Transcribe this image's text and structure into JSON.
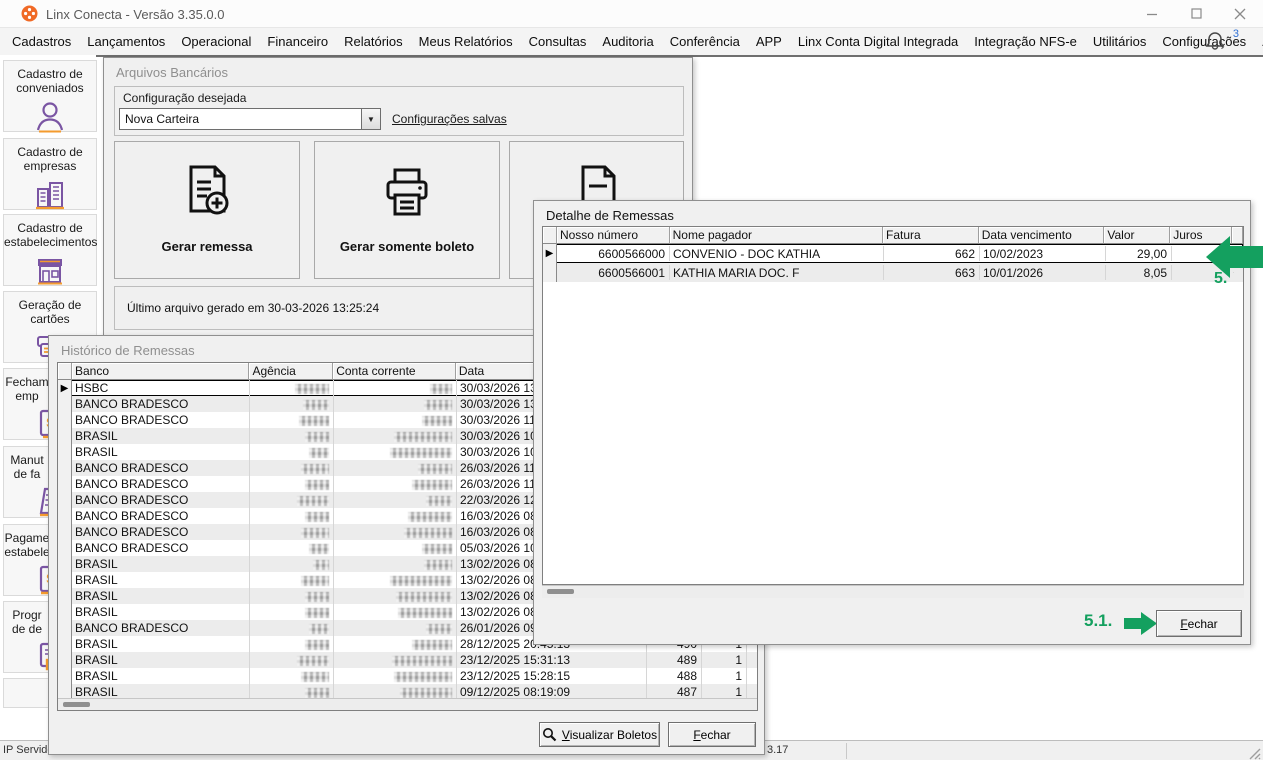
{
  "colors": {
    "green": "#14a05f",
    "purple": "#7a55a3",
    "orange": "#f49b2e",
    "logo_orange": "#f06a26",
    "bell_badge_blue": "#2f6fd4"
  },
  "app": {
    "title": "Linx Conecta - Versão 3.35.0.0",
    "bell_count": "3",
    "status_left": "IP Servido",
    "status_right": "3.17"
  },
  "menu": {
    "items": [
      "Cadastros",
      "Lançamentos",
      "Operacional",
      "Financeiro",
      "Relatórios",
      "Meus Relatórios",
      "Consultas",
      "Auditoria",
      "Conferência",
      "APP",
      "Linx Conta Digital Integrada",
      "Integração NFS-e",
      "Utilitários",
      "Configurações",
      "Ajuda"
    ]
  },
  "sidebar": {
    "items": [
      {
        "line1": "Cadastro de",
        "line2": "conveniados",
        "icon": "person-icon",
        "clipped": false
      },
      {
        "line1": "Cadastro de",
        "line2": "empresas",
        "icon": "buildings-icon",
        "clipped": false
      },
      {
        "line1": "Cadastro de",
        "line2": "estabelecimentos",
        "icon": "store-icon",
        "clipped": false
      },
      {
        "line1": "Geração de",
        "line2": "cartões",
        "icon": "cards-icon",
        "clipped": false
      },
      {
        "line1": "Fecham",
        "line2": "emp",
        "icon": "money-doc-icon",
        "clipped": true
      },
      {
        "line1": "Manut",
        "line2": "de fa",
        "icon": "invoice-icon",
        "clipped": true
      },
      {
        "line1": "Pagame",
        "line2": "estabele",
        "icon": "payment-doc-icon",
        "clipped": true
      },
      {
        "line1": "Progr",
        "line2": "de de",
        "icon": "schedule-doc-icon",
        "clipped": true
      }
    ]
  },
  "arquivos_bancarios": {
    "title": "Arquivos Bancários",
    "config_group_label": "Configuração desejada",
    "config_value": "Nova Carteira",
    "link_label": "Configurações salvas",
    "button1_label": "Gerar remessa",
    "button2_label": "Gerar somente boleto",
    "last_file_text": "Último arquivo gerado em 30-03-2026 13:25:24"
  },
  "historico": {
    "title": "Histórico de Remessas",
    "columns": [
      "Banco",
      "Agência",
      "Conta corrente",
      "Data"
    ],
    "rows": [
      {
        "banco": "HSBC",
        "data": "30/03/2026 13",
        "c5": "",
        "c6": "",
        "selected": true
      },
      {
        "banco": "BANCO BRADESCO",
        "data": "30/03/2026 13",
        "c5": "",
        "c6": "",
        "selected": false
      },
      {
        "banco": "BANCO BRADESCO",
        "data": "30/03/2026 11",
        "c5": "",
        "c6": "",
        "selected": false
      },
      {
        "banco": "BRASIL",
        "data": "30/03/2026 10",
        "c5": "",
        "c6": "",
        "selected": false
      },
      {
        "banco": "BRASIL",
        "data": "30/03/2026 10",
        "c5": "",
        "c6": "",
        "selected": false
      },
      {
        "banco": "BANCO BRADESCO",
        "data": "26/03/2026 11",
        "c5": "",
        "c6": "",
        "selected": false
      },
      {
        "banco": "BANCO BRADESCO",
        "data": "26/03/2026 11",
        "c5": "",
        "c6": "",
        "selected": false
      },
      {
        "banco": "BANCO BRADESCO",
        "data": "22/03/2026 12",
        "c5": "",
        "c6": "",
        "selected": false
      },
      {
        "banco": "BANCO BRADESCO",
        "data": "16/03/2026 08",
        "c5": "",
        "c6": "",
        "selected": false
      },
      {
        "banco": "BANCO BRADESCO",
        "data": "16/03/2026 08",
        "c5": "",
        "c6": "",
        "selected": false
      },
      {
        "banco": "BANCO BRADESCO",
        "data": "05/03/2026 10",
        "c5": "",
        "c6": "",
        "selected": false
      },
      {
        "banco": "BRASIL",
        "data": "13/02/2026 08",
        "c5": "",
        "c6": "",
        "selected": false
      },
      {
        "banco": "BRASIL",
        "data": "13/02/2026 08",
        "c5": "",
        "c6": "",
        "selected": false
      },
      {
        "banco": "BRASIL",
        "data": "13/02/2026 08",
        "c5": "",
        "c6": "",
        "selected": false
      },
      {
        "banco": "BRASIL",
        "data": "13/02/2026 08",
        "c5": "",
        "c6": "",
        "selected": false
      },
      {
        "banco": "BANCO BRADESCO",
        "data": "26/01/2026 09",
        "c5": "",
        "c6": "",
        "selected": false
      },
      {
        "banco": "BRASIL",
        "data": "28/12/2025 20:45:13",
        "c5": "490",
        "c6": "1",
        "selected": false
      },
      {
        "banco": "BRASIL",
        "data": "23/12/2025 15:31:13",
        "c5": "489",
        "c6": "1",
        "selected": false
      },
      {
        "banco": "BRASIL",
        "data": "23/12/2025 15:28:15",
        "c5": "488",
        "c6": "1",
        "selected": false
      },
      {
        "banco": "BRASIL",
        "data": "09/12/2025 08:19:09",
        "c5": "487",
        "c6": "1",
        "selected": false
      }
    ],
    "visualizar_label": "Visualizar Boletos",
    "fechar_label": "Fechar"
  },
  "detalhe": {
    "title": "Detalhe de Remessas",
    "columns": [
      "Nosso número",
      "Nome pagador",
      "Fatura",
      "Data vencimento",
      "Valor",
      "Juros"
    ],
    "rows": [
      {
        "nosso_numero": "6600566000",
        "nome_pagador": "CONVENIO -  DOC KATHIA",
        "fatura": "662",
        "data_vencimento": "10/02/2023",
        "valor": "29,00",
        "juros": "",
        "selected": true
      },
      {
        "nosso_numero": "6600566001",
        "nome_pagador": "KATHIA MARIA DOC. F",
        "fatura": "663",
        "data_vencimento": "10/01/2026",
        "valor": "8,05",
        "juros": "",
        "selected": false
      }
    ],
    "fechar_label": "Fechar"
  },
  "annotations": {
    "step5": "5.",
    "step51": "5.1."
  }
}
